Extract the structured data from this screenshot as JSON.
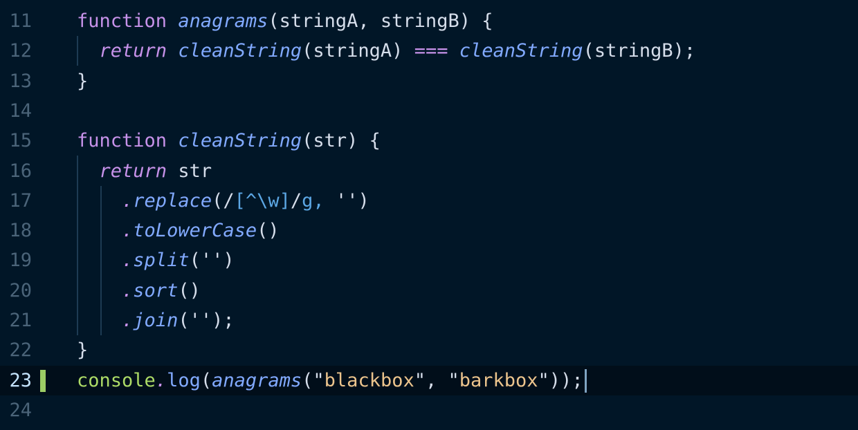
{
  "editor": {
    "active_line": 23,
    "lines": [
      {
        "no": "11",
        "tokens": [
          {
            "t": "function",
            "c": "kw"
          },
          {
            "t": " ",
            "c": "plain"
          },
          {
            "t": "anagrams",
            "c": "fn-i"
          },
          {
            "t": "(stringA, stringB) {",
            "c": "plain"
          }
        ]
      },
      {
        "no": "12",
        "tokens": [
          {
            "t": "  ",
            "c": "plain"
          },
          {
            "t": "return",
            "c": "kw-i"
          },
          {
            "t": " ",
            "c": "plain"
          },
          {
            "t": "cleanString",
            "c": "fn-i"
          },
          {
            "t": "(stringA) ",
            "c": "plain"
          },
          {
            "t": "===",
            "c": "op"
          },
          {
            "t": " ",
            "c": "plain"
          },
          {
            "t": "cleanString",
            "c": "fn-i"
          },
          {
            "t": "(stringB);",
            "c": "plain"
          }
        ]
      },
      {
        "no": "13",
        "tokens": [
          {
            "t": "}",
            "c": "plain"
          }
        ]
      },
      {
        "no": "14",
        "tokens": []
      },
      {
        "no": "15",
        "tokens": [
          {
            "t": "function",
            "c": "kw"
          },
          {
            "t": " ",
            "c": "plain"
          },
          {
            "t": "cleanString",
            "c": "fn-i"
          },
          {
            "t": "(str) {",
            "c": "plain"
          }
        ]
      },
      {
        "no": "16",
        "tokens": [
          {
            "t": "  ",
            "c": "plain"
          },
          {
            "t": "return",
            "c": "kw-i"
          },
          {
            "t": " str",
            "c": "plain"
          }
        ]
      },
      {
        "no": "17",
        "tokens": [
          {
            "t": "    ",
            "c": "plain"
          },
          {
            "t": ".",
            "c": "dot"
          },
          {
            "t": "replace",
            "c": "fn-i"
          },
          {
            "t": "(/",
            "c": "plain"
          },
          {
            "t": "[^\\w]",
            "c": "rx"
          },
          {
            "t": "/",
            "c": "plain"
          },
          {
            "t": "g",
            "c": "rx"
          },
          {
            "t": ", ",
            "c": "rx"
          },
          {
            "t": "'')",
            "c": "plain"
          }
        ]
      },
      {
        "no": "18",
        "tokens": [
          {
            "t": "    ",
            "c": "plain"
          },
          {
            "t": ".",
            "c": "dot"
          },
          {
            "t": "toLowerCase",
            "c": "fn-i"
          },
          {
            "t": "()",
            "c": "plain"
          }
        ]
      },
      {
        "no": "19",
        "tokens": [
          {
            "t": "    ",
            "c": "plain"
          },
          {
            "t": ".",
            "c": "dot"
          },
          {
            "t": "split",
            "c": "fn-i"
          },
          {
            "t": "('')",
            "c": "plain"
          }
        ]
      },
      {
        "no": "20",
        "tokens": [
          {
            "t": "    ",
            "c": "plain"
          },
          {
            "t": ".",
            "c": "dot"
          },
          {
            "t": "sort",
            "c": "fn-i"
          },
          {
            "t": "()",
            "c": "plain"
          }
        ]
      },
      {
        "no": "21",
        "tokens": [
          {
            "t": "    ",
            "c": "plain"
          },
          {
            "t": ".",
            "c": "dot"
          },
          {
            "t": "join",
            "c": "fn-i"
          },
          {
            "t": "('');",
            "c": "plain"
          }
        ]
      },
      {
        "no": "22",
        "tokens": [
          {
            "t": "}",
            "c": "plain"
          }
        ]
      },
      {
        "no": "23",
        "tokens": [
          {
            "t": "console",
            "c": "console"
          },
          {
            "t": ".",
            "c": "dot"
          },
          {
            "t": "log",
            "c": "fn"
          },
          {
            "t": "(",
            "c": "plain"
          },
          {
            "t": "anagrams",
            "c": "fn-i"
          },
          {
            "t": "(\"",
            "c": "plain"
          },
          {
            "t": "blackbox",
            "c": "str"
          },
          {
            "t": "\", \"",
            "c": "plain"
          },
          {
            "t": "barkbox",
            "c": "str"
          },
          {
            "t": "\"));",
            "c": "plain"
          }
        ]
      },
      {
        "no": "24",
        "tokens": []
      }
    ]
  }
}
